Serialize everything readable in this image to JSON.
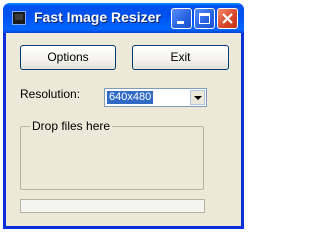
{
  "window": {
    "title": "Fast Image Resizer",
    "icon": "app-icon"
  },
  "title_buttons": {
    "minimize_icon": "minimize-icon",
    "maximize_icon": "maximize-icon",
    "close_icon": "close-icon"
  },
  "toolbar": {
    "options_label": "Options",
    "exit_label": "Exit"
  },
  "resolution": {
    "label": "Resolution:",
    "selected": "640x480"
  },
  "drop_area": {
    "label": "Drop files here"
  },
  "status": {
    "text": ""
  },
  "colors": {
    "titlebar": "#0050ee",
    "window_border": "#0831d9",
    "client_background": "#ece9d8",
    "selection": "#316ac5",
    "close_button": "#d8442a"
  }
}
